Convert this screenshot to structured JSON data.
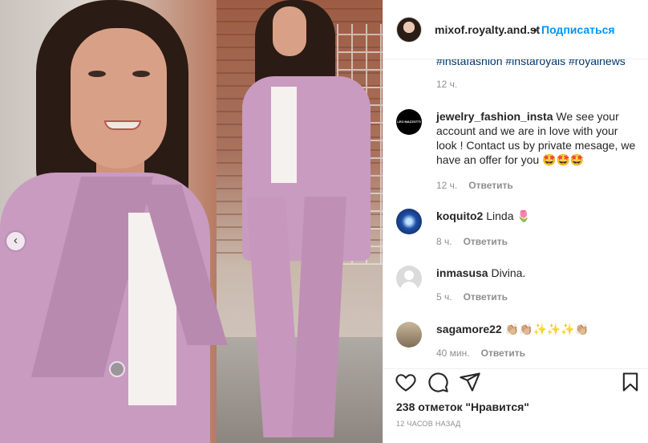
{
  "post": {
    "carousel_prev_icon": "‹"
  },
  "header": {
    "username": "mixof.royalty.and.st",
    "separator": "•",
    "follow_label": "Подписаться"
  },
  "caption": {
    "hashtags": "#instafashion #instaroyals #royalnews",
    "time": "12 ч."
  },
  "comments": [
    {
      "username": "jewelry_fashion_insta",
      "text": "We see your account and we are in love with your look ! Contact us by private mesage, we have an offer for you 🤩🤩🤩",
      "time": "12 ч.",
      "reply": "Ответить",
      "avatar_text": "LEO MAZZOTTI"
    },
    {
      "username": "koquito2",
      "text": "Linda 🌷",
      "time": "8 ч.",
      "reply": "Ответить"
    },
    {
      "username": "inmasusa",
      "text": "Divina.",
      "time": "5 ч.",
      "reply": "Ответить"
    },
    {
      "username": "sagamore22",
      "text": "👏🏼👏🏼✨✨✨👏🏼",
      "time": "40 мин.",
      "reply": "Ответить"
    }
  ],
  "footer": {
    "likes": "238 отметок \"Нравится\"",
    "posted": "12 ЧАСОВ НАЗАД",
    "icons": [
      "heart-icon",
      "comment-icon",
      "share-icon",
      "bookmark-icon"
    ]
  }
}
